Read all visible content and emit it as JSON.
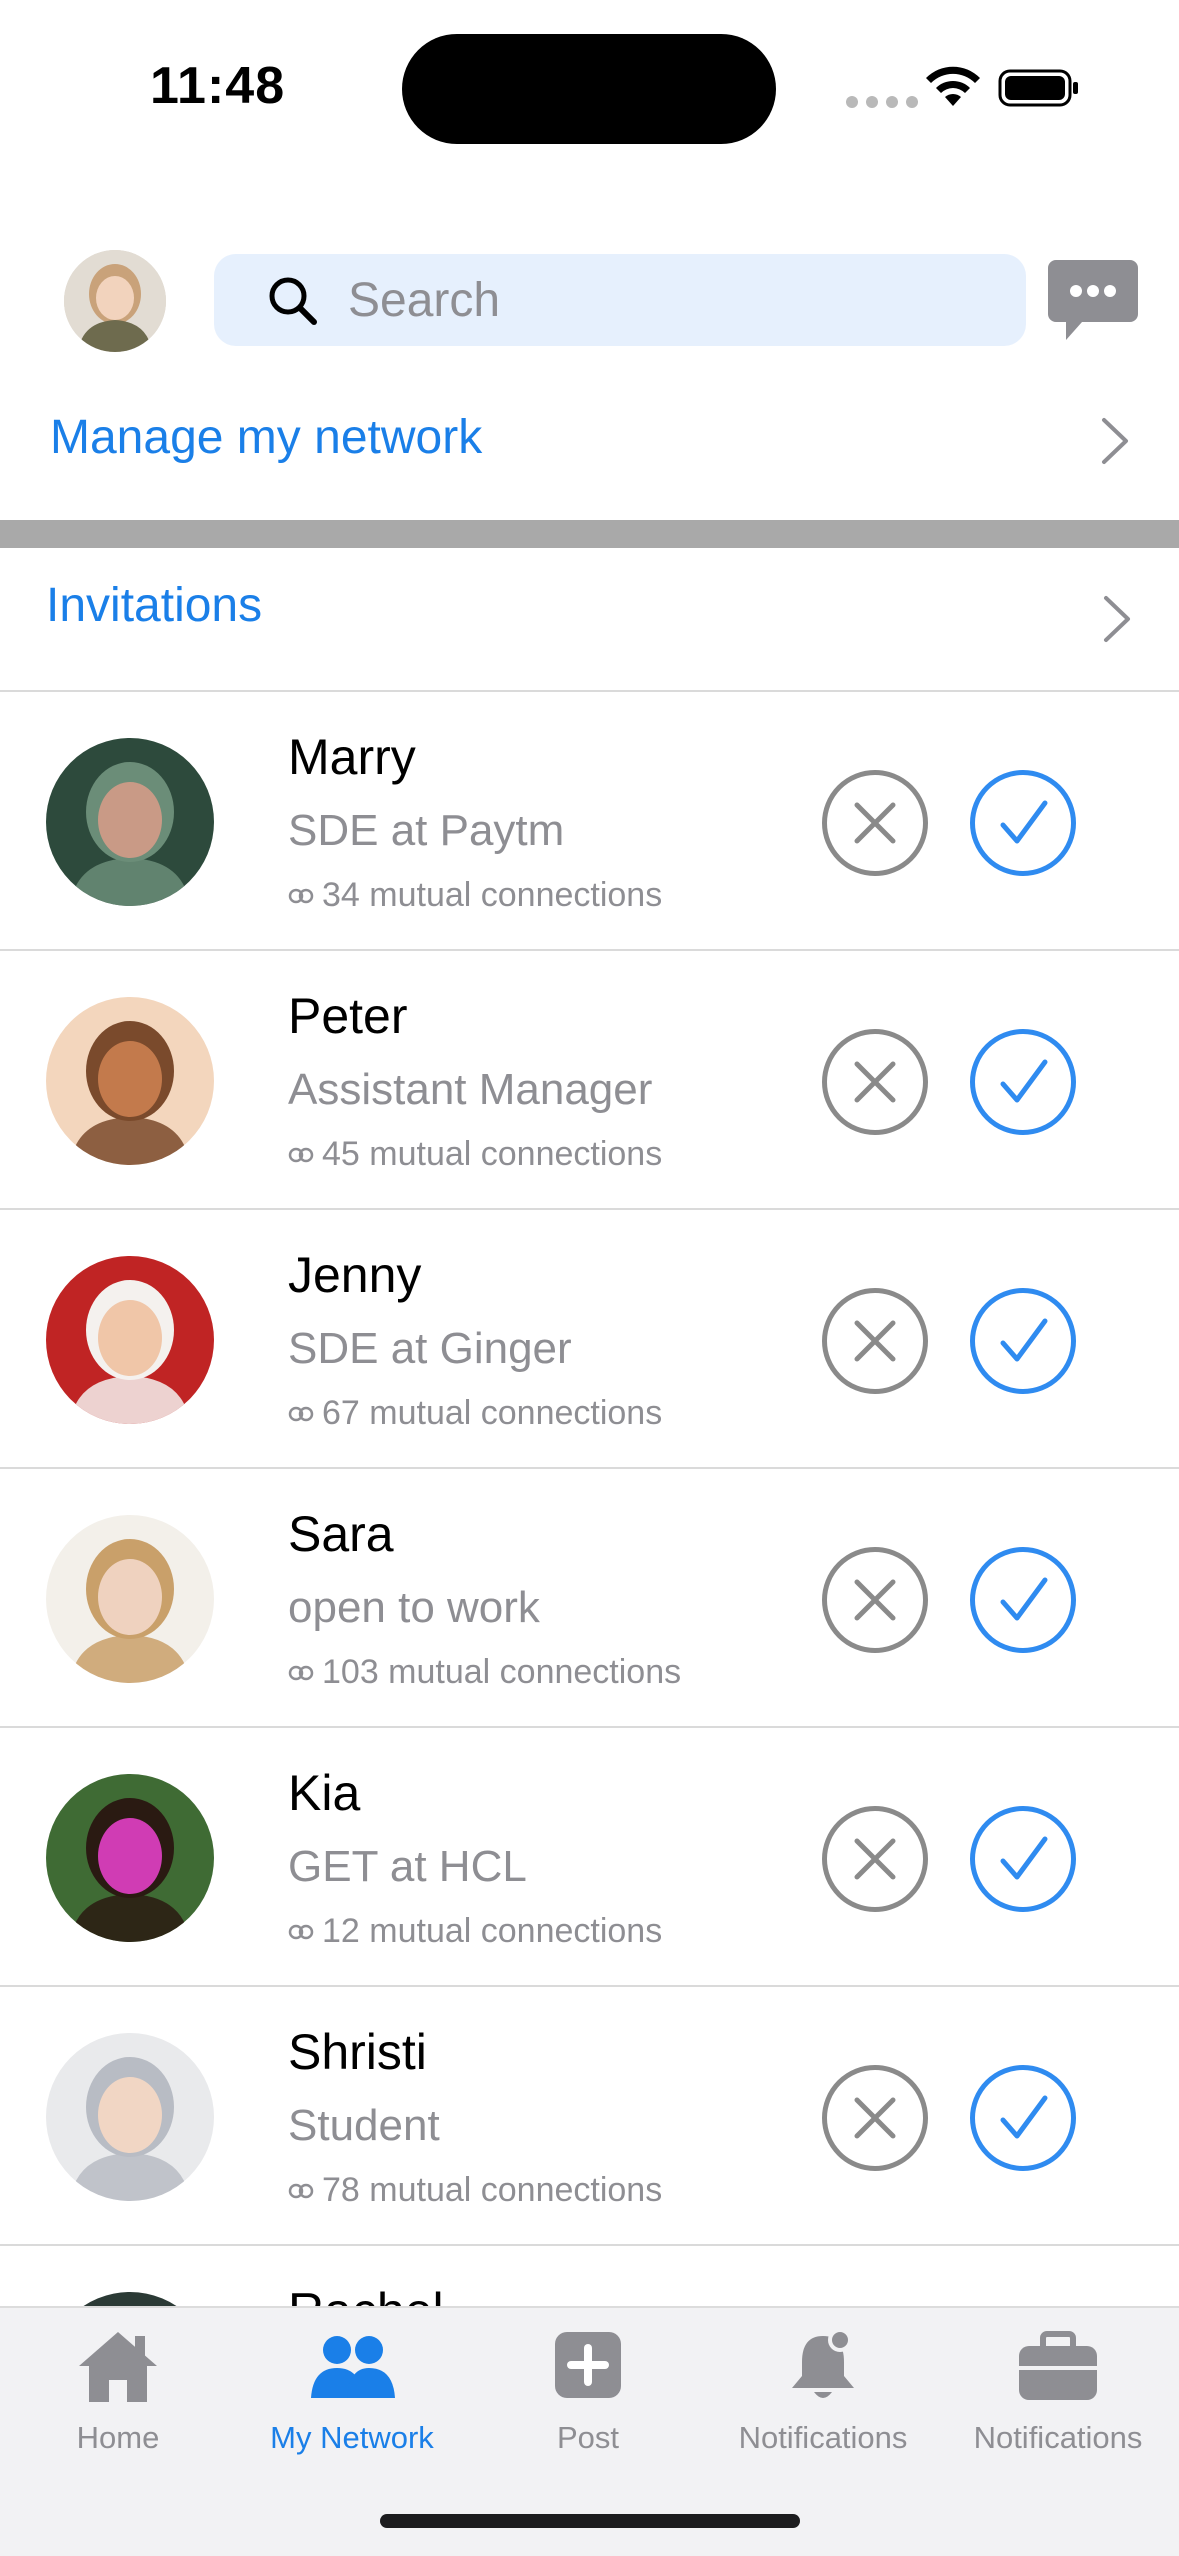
{
  "status_bar": {
    "time": "11:48"
  },
  "header": {
    "search": {
      "placeholder": "Search",
      "value": ""
    }
  },
  "manage_network": {
    "label": "Manage my network"
  },
  "invitations": {
    "label": "Invitations",
    "items": [
      {
        "name": "Marry",
        "title": "SDE at Paytm",
        "mutual": "34 mutual connections",
        "photo_colors": [
          "#2d4a3c",
          "#6b8d78",
          "#c99a86"
        ]
      },
      {
        "name": "Peter",
        "title": "Assistant Manager",
        "mutual": "45 mutual connections",
        "photo_colors": [
          "#f3d6bd",
          "#7a4a2c",
          "#c37a4c"
        ]
      },
      {
        "name": "Jenny",
        "title": "SDE at Ginger",
        "mutual": "67 mutual connections",
        "photo_colors": [
          "#c02424",
          "#f4f1ee",
          "#f0c6a8"
        ]
      },
      {
        "name": "Sara",
        "title": "open to work",
        "mutual": "103 mutual connections",
        "photo_colors": [
          "#f3f0ea",
          "#c9a06a",
          "#efd2bf"
        ]
      },
      {
        "name": "Kia",
        "title": "GET at HCL",
        "mutual": "12 mutual connections",
        "photo_colors": [
          "#3f6b34",
          "#2a1a12",
          "#d03cb4"
        ]
      },
      {
        "name": "Shristi",
        "title": "Student",
        "mutual": "78 mutual connections",
        "photo_colors": [
          "#e9eaec",
          "#b8bcc4",
          "#f1d6c4"
        ]
      },
      {
        "name": "Rachel",
        "title": "",
        "mutual": "",
        "photo_colors": [
          "#2b3a35",
          "#6b7a74",
          "#d8b8a0"
        ]
      }
    ]
  },
  "tab_bar": {
    "tabs": [
      {
        "label": "Home",
        "icon": "home-icon",
        "active": false
      },
      {
        "label": "My Network",
        "icon": "people-icon",
        "active": true
      },
      {
        "label": "Post",
        "icon": "plus-square-icon",
        "active": false
      },
      {
        "label": "Notifications",
        "icon": "bell-icon",
        "active": false
      },
      {
        "label": "Notifications",
        "icon": "briefcase-icon",
        "active": false
      }
    ]
  },
  "colors": {
    "accent": "#1a7fe8",
    "accept": "#2f8bf0",
    "reject": "#8a8a8a",
    "search_bg": "#e6f0fd"
  }
}
